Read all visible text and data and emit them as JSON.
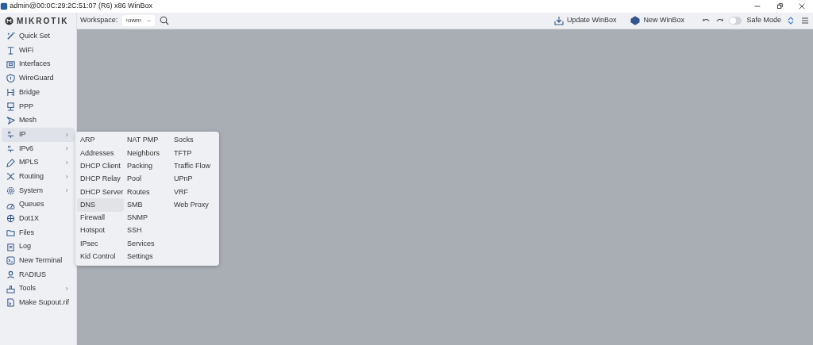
{
  "window": {
    "title": "admin@00:0C:29:2C:51:07 (R6) x86 WinBox"
  },
  "logo": {
    "text": "MIKROTIK"
  },
  "toolbar": {
    "workspace_label": "Workspace:",
    "workspace_value": "‹own›",
    "update_button": "Update WinBox",
    "new_button": "New WinBox",
    "safe_mode": {
      "label": "Safe Mode",
      "on": false
    }
  },
  "sidebar": {
    "items": [
      {
        "label": "Quick Set",
        "submenu": false,
        "selected": false
      },
      {
        "label": "WiFi",
        "submenu": false,
        "selected": false
      },
      {
        "label": "Interfaces",
        "submenu": false,
        "selected": false
      },
      {
        "label": "WireGuard",
        "submenu": false,
        "selected": false
      },
      {
        "label": "Bridge",
        "submenu": false,
        "selected": false
      },
      {
        "label": "PPP",
        "submenu": false,
        "selected": false
      },
      {
        "label": "Mesh",
        "submenu": false,
        "selected": false
      },
      {
        "label": "IP",
        "submenu": true,
        "selected": true
      },
      {
        "label": "IPv6",
        "submenu": true,
        "selected": false
      },
      {
        "label": "MPLS",
        "submenu": true,
        "selected": false
      },
      {
        "label": "Routing",
        "submenu": true,
        "selected": false
      },
      {
        "label": "System",
        "submenu": true,
        "selected": false
      },
      {
        "label": "Queues",
        "submenu": false,
        "selected": false
      },
      {
        "label": "Dot1X",
        "submenu": false,
        "selected": false
      },
      {
        "label": "Files",
        "submenu": false,
        "selected": false
      },
      {
        "label": "Log",
        "submenu": false,
        "selected": false
      },
      {
        "label": "New Terminal",
        "submenu": false,
        "selected": false
      },
      {
        "label": "RADIUS",
        "submenu": false,
        "selected": false
      },
      {
        "label": "Tools",
        "submenu": true,
        "selected": false
      },
      {
        "label": "Make Supout.rif",
        "submenu": false,
        "selected": false
      }
    ]
  },
  "submenu": {
    "columns": [
      [
        {
          "label": "ARP",
          "selected": false
        },
        {
          "label": "Addresses",
          "selected": false
        },
        {
          "label": "DHCP Client",
          "selected": false
        },
        {
          "label": "DHCP Relay",
          "selected": false
        },
        {
          "label": "DHCP Server",
          "selected": false
        },
        {
          "label": "DNS",
          "selected": true
        },
        {
          "label": "Firewall",
          "selected": false
        },
        {
          "label": "Hotspot",
          "selected": false
        },
        {
          "label": "IPsec",
          "selected": false
        },
        {
          "label": "Kid Control",
          "selected": false
        }
      ],
      [
        {
          "label": "NAT PMP",
          "selected": false
        },
        {
          "label": "Neighbors",
          "selected": false
        },
        {
          "label": "Packing",
          "selected": false
        },
        {
          "label": "Pool",
          "selected": false
        },
        {
          "label": "Routes",
          "selected": false
        },
        {
          "label": "SMB",
          "selected": false
        },
        {
          "label": "SNMP",
          "selected": false
        },
        {
          "label": "SSH",
          "selected": false
        },
        {
          "label": "Services",
          "selected": false
        },
        {
          "label": "Settings",
          "selected": false
        }
      ],
      [
        {
          "label": "Socks",
          "selected": false
        },
        {
          "label": "TFTP",
          "selected": false
        },
        {
          "label": "Traffic Flow",
          "selected": false
        },
        {
          "label": "UPnP",
          "selected": false
        },
        {
          "label": "VRF",
          "selected": false
        },
        {
          "label": "Web Proxy",
          "selected": false
        }
      ]
    ]
  }
}
